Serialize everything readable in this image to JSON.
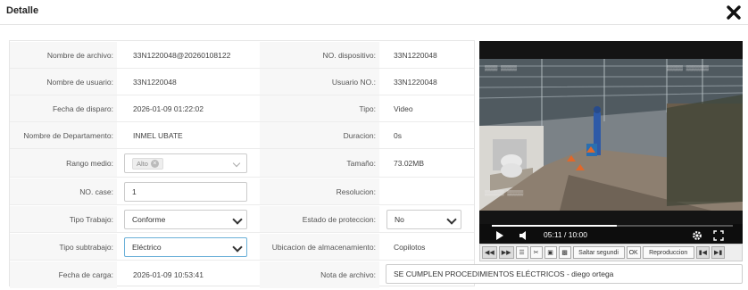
{
  "dialog": {
    "title": "Detalle"
  },
  "fields": {
    "nombre_archivo": {
      "label": "Nombre de archivo:",
      "value": "33N1220048@20260108122"
    },
    "no_dispositivo": {
      "label": "NO. dispositivo:",
      "value": "33N1220048"
    },
    "nombre_usuario": {
      "label": "Nombre de usuario:",
      "value": "33N1220048"
    },
    "usuario_no": {
      "label": "Usuario NO.:",
      "value": "33N1220048"
    },
    "fecha_disparo": {
      "label": "Fecha de disparo:",
      "value": "2026-01-09 01:22:02"
    },
    "tipo": {
      "label": "Tipo:",
      "value": "Video"
    },
    "nombre_departamento": {
      "label": "Nombre de Departamento:",
      "value": "INMEL UBATE"
    },
    "duracion": {
      "label": "Duracion:",
      "value": "0s"
    },
    "rango_medio": {
      "label": "Rango medio:",
      "tag": "Alto"
    },
    "tamano": {
      "label": "Tamaño:",
      "value": "73.02MB"
    },
    "no_case": {
      "label": "NO. case:",
      "value": "1"
    },
    "resolucion": {
      "label": "Resolucion:",
      "value": ""
    },
    "tipo_trabajo": {
      "label": "Tipo Trabajo:",
      "value": "Conforme"
    },
    "estado_proteccion": {
      "label": "Estado de proteccion:",
      "value": "No"
    },
    "tipo_subtrabajo": {
      "label": "Tipo subtrabajo:",
      "value": "Eléctrico"
    },
    "ubicacion": {
      "label": "Ubicacion de almacenamiento:",
      "value": "Copilotos"
    },
    "fecha_carga": {
      "label": "Fecha de carga:",
      "value": "2026-01-09 10:53:41"
    },
    "nota_archivo": {
      "label": "Nota de archivo:",
      "value": "SE CUMPLEN PROCEDIMIENTOS ELÉCTRICOS - diego ortega"
    }
  },
  "player": {
    "current_time": "05:11",
    "duration": "10:00",
    "progress": 0.52,
    "time_display": "05:11 / 10:00"
  },
  "toolbar": {
    "skip_label": "Saltar segundi",
    "ok_label": "OK",
    "playback_label": "Reproduccion"
  }
}
